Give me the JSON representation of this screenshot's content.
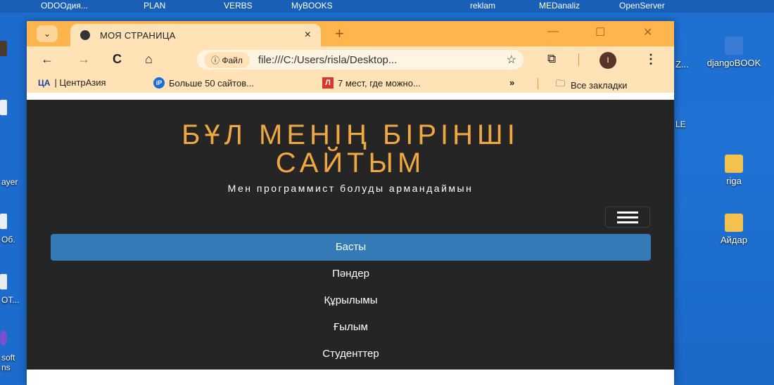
{
  "desktop": {
    "top_items": [
      "ODOOдия...",
      "PLAN",
      "VERBS",
      "MyBOOKS",
      "reklam",
      "MEDanaliz",
      "OpenServer"
    ],
    "left_labels": [
      "ayer",
      "Об.",
      "OT...",
      "soft",
      "ns"
    ],
    "right_overflow": "Z...",
    "right_le": "LE",
    "icons": [
      {
        "label": "djangoBOOK",
        "color": "#3a7bd5"
      },
      {
        "label": "riga",
        "color": "#f2c14e"
      },
      {
        "label": "Айдар",
        "color": "#f2c14e"
      }
    ]
  },
  "browser": {
    "tab_title": "МОЯ СТРАНИЦА",
    "tab_close": "×",
    "new_tab": "+",
    "window_controls": {
      "minimize": "—",
      "maximize": "☐",
      "close": "✕"
    },
    "nav": {
      "back": "←",
      "forward": "→",
      "reload": "C",
      "home": "⌂"
    },
    "address": {
      "chip": "ⓘ Файл",
      "url": "file:///C:/Users/risla/Desktop...",
      "star": "☆"
    },
    "profile_initial": "I",
    "menu_glyph": "⋮",
    "extensions_glyph": "⧉",
    "dropdown_glyph": "⌄",
    "bookmarks": [
      {
        "badge": "ЦА",
        "label": "| ЦентрАзия"
      },
      {
        "badge": "iP",
        "label": "Больше 50 сайтов..."
      },
      {
        "badge": "Л",
        "label": "7 мест, где можно..."
      }
    ],
    "bookmarks_more": "»",
    "all_bookmarks": "Все закладки",
    "folder_glyph": "🗀"
  },
  "site": {
    "title_line1": "БҰЛ МЕНІҢ БІРІНШІ",
    "title_line2": "САЙТЫМ",
    "subtitle": "Мен программист болуды армандаймын",
    "menu": [
      "Басты",
      "Пәндер",
      "Құрылымы",
      "Ғылым",
      "Студенттер"
    ],
    "active_index": 0,
    "accent_color": "#f0a843",
    "active_color": "#337ab7",
    "background_color": "#252525"
  }
}
